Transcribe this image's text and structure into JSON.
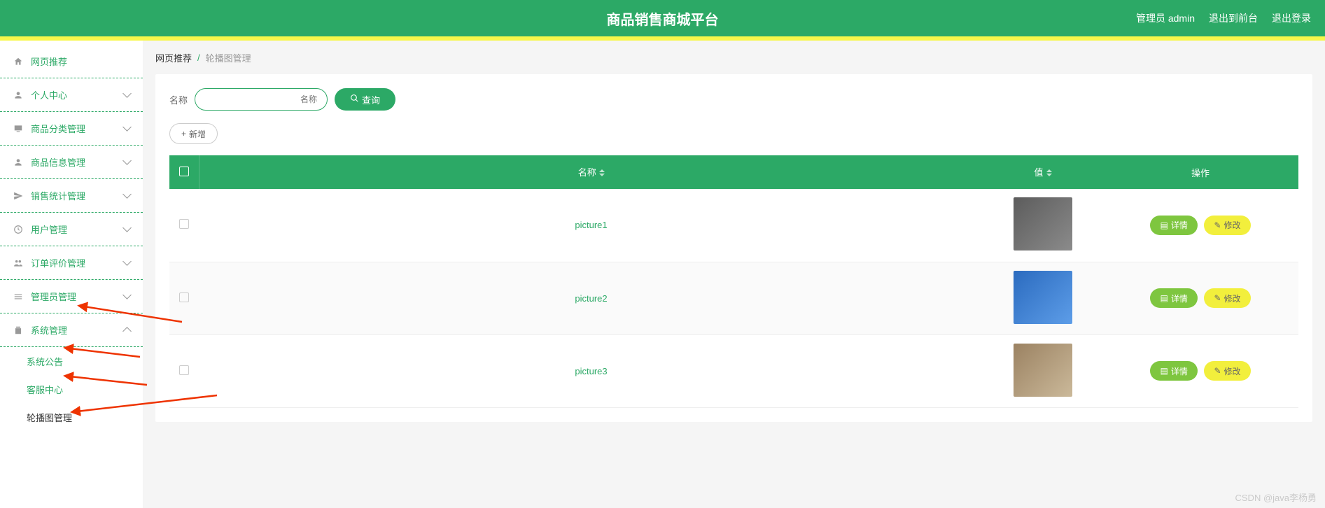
{
  "header": {
    "title": "商品销售商城平台",
    "admin_label": "管理员 admin",
    "exit_front": "退出到前台",
    "logout": "退出登录"
  },
  "sidebar": {
    "items": [
      {
        "label": "网页推荐",
        "icon": "home"
      },
      {
        "label": "个人中心",
        "icon": "user",
        "chevron": true
      },
      {
        "label": "商品分类管理",
        "icon": "monitor",
        "chevron": true
      },
      {
        "label": "商品信息管理",
        "icon": "person",
        "chevron": true
      },
      {
        "label": "销售统计管理",
        "icon": "send",
        "chevron": true
      },
      {
        "label": "用户管理",
        "icon": "clock",
        "chevron": true
      },
      {
        "label": "订单评价管理",
        "icon": "people",
        "chevron": true
      },
      {
        "label": "管理员管理",
        "icon": "menu",
        "chevron": true
      },
      {
        "label": "系统管理",
        "icon": "clipboard",
        "chevron": true,
        "expanded": true
      }
    ],
    "subitems": [
      {
        "label": "系统公告"
      },
      {
        "label": "客服中心"
      },
      {
        "label": "轮播图管理",
        "active": true
      }
    ]
  },
  "breadcrumb": {
    "root": "网页推荐",
    "current": "轮播图管理"
  },
  "search": {
    "label": "名称",
    "placeholder": "名称",
    "button": "查询"
  },
  "add_button": "新增",
  "table": {
    "headers": {
      "name": "名称",
      "value": "值",
      "op": "操作"
    },
    "rows": [
      {
        "name": "picture1"
      },
      {
        "name": "picture2"
      },
      {
        "name": "picture3"
      }
    ],
    "detail_label": "详情",
    "edit_label": "修改"
  },
  "watermark": "CSDN @java李杨勇"
}
